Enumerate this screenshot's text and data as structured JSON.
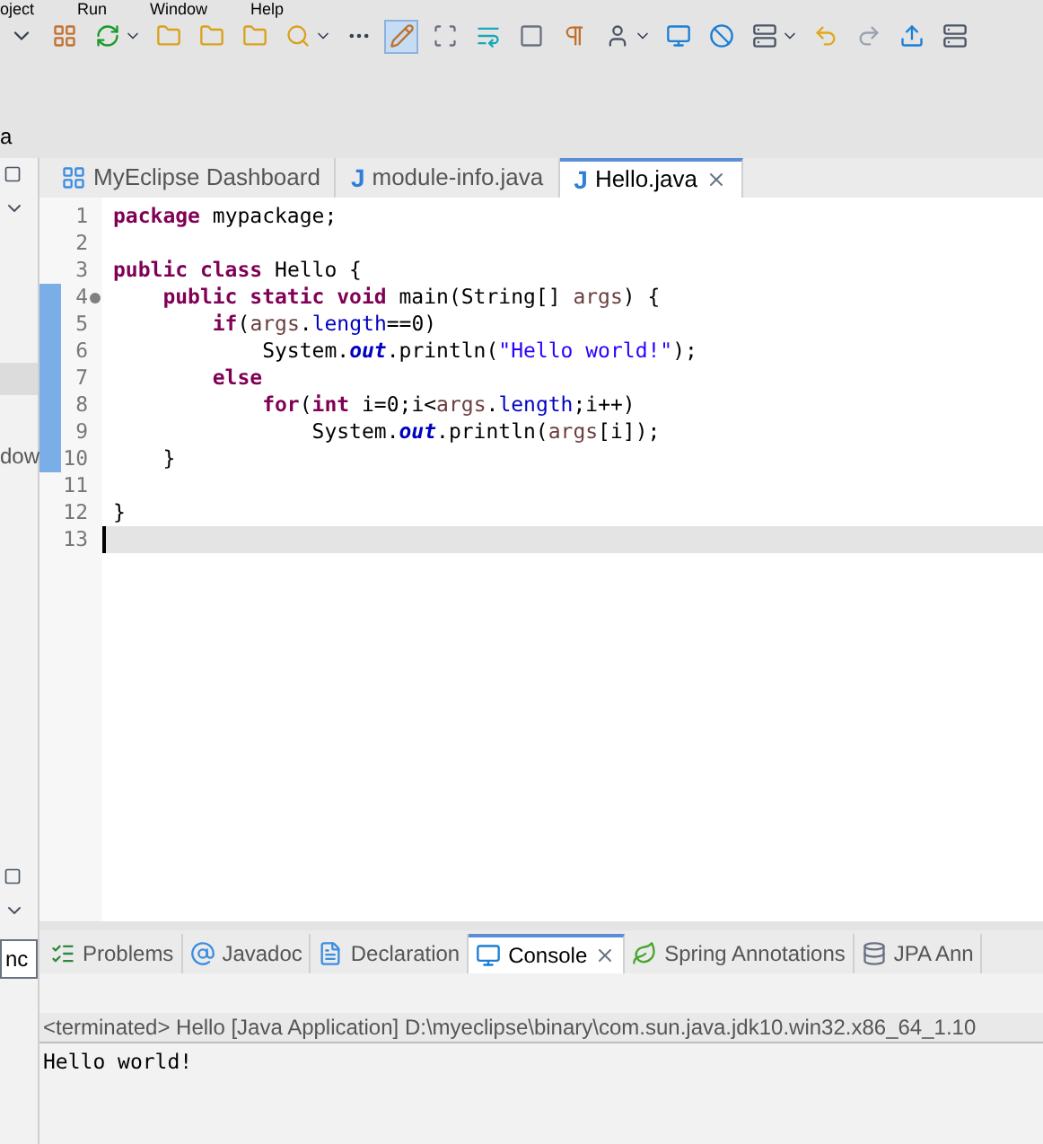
{
  "menu": [
    "oject",
    "Run",
    "Window",
    "Help"
  ],
  "toolbar": [
    {
      "selected": false
    },
    {
      "selected": false
    },
    {
      "selected": false
    },
    {
      "selected": false
    },
    {
      "selected": false
    },
    {
      "selected": false
    },
    {
      "selected": false
    },
    {
      "selected": false
    },
    {
      "selected": true
    },
    {
      "selected": false
    },
    {
      "selected": false
    },
    {
      "selected": false
    },
    {
      "selected": false
    },
    {
      "selected": false
    },
    {
      "selected": false
    },
    {
      "selected": false
    },
    {
      "selected": false
    },
    {
      "selected": false
    },
    {
      "selected": false
    },
    {
      "selected": false
    },
    {
      "selected": false
    }
  ],
  "left_panel": {
    "label_top": "a",
    "label_mid": "dow",
    "field_value": "nc"
  },
  "editor_tabs": [
    {
      "label": "MyEclipse Dashboard",
      "kind": "dashboard",
      "selected": false
    },
    {
      "label": "module-info.java",
      "kind": "java",
      "icon_text": "J",
      "selected": false
    },
    {
      "label": "Hello.java",
      "kind": "java",
      "icon_text": "J",
      "selected": true
    }
  ],
  "code_lines": [
    {
      "number": "1",
      "changed": false,
      "marker": false,
      "current": false,
      "tokens": [
        {
          "kind": "keyword",
          "text": "package"
        },
        {
          "kind": "plain",
          "text": " mypackage;"
        }
      ]
    },
    {
      "number": "2",
      "changed": false,
      "marker": false,
      "current": false
    },
    {
      "number": "3",
      "changed": false,
      "marker": false,
      "current": false,
      "tokens": [
        {
          "kind": "keyword",
          "text": "public class"
        },
        {
          "kind": "plain",
          "text": " Hello {"
        }
      ]
    },
    {
      "number": "4",
      "changed": true,
      "marker": true,
      "current": false,
      "tokens": [
        {
          "kind": "keyword",
          "text": "    public static void"
        },
        {
          "kind": "plain",
          "text": " main(String[] "
        },
        {
          "kind": "variable",
          "text": "args"
        },
        {
          "kind": "plain",
          "text": ") {"
        }
      ]
    },
    {
      "number": "5",
      "changed": true,
      "marker": false,
      "current": false,
      "tokens": [
        {
          "kind": "keyword",
          "text": "        if"
        },
        {
          "kind": "plain",
          "text": "("
        },
        {
          "kind": "variable",
          "text": "args"
        },
        {
          "kind": "plain",
          "text": "."
        },
        {
          "kind": "field",
          "text": "length"
        },
        {
          "kind": "plain",
          "text": "==0)"
        }
      ]
    },
    {
      "number": "6",
      "changed": true,
      "marker": false,
      "current": false,
      "tokens": [
        {
          "kind": "plain",
          "text": "            System."
        },
        {
          "kind": "static",
          "text": "out"
        },
        {
          "kind": "plain",
          "text": ".println("
        },
        {
          "kind": "string",
          "text": "\"Hello world!\""
        },
        {
          "kind": "plain",
          "text": ");"
        }
      ]
    },
    {
      "number": "7",
      "changed": true,
      "marker": false,
      "current": false,
      "tokens": [
        {
          "kind": "keyword",
          "text": "        else"
        }
      ]
    },
    {
      "number": "8",
      "changed": true,
      "marker": false,
      "current": false,
      "tokens": [
        {
          "kind": "keyword",
          "text": "            for"
        },
        {
          "kind": "plain",
          "text": "("
        },
        {
          "kind": "keyword",
          "text": "int"
        },
        {
          "kind": "plain",
          "text": " i=0;i<"
        },
        {
          "kind": "variable",
          "text": "args"
        },
        {
          "kind": "plain",
          "text": "."
        },
        {
          "kind": "field",
          "text": "length"
        },
        {
          "kind": "plain",
          "text": ";i++)"
        }
      ]
    },
    {
      "number": "9",
      "changed": true,
      "marker": false,
      "current": false,
      "tokens": [
        {
          "kind": "plain",
          "text": "                System."
        },
        {
          "kind": "static",
          "text": "out"
        },
        {
          "kind": "plain",
          "text": ".println("
        },
        {
          "kind": "variable",
          "text": "args"
        },
        {
          "kind": "plain",
          "text": "[i]);"
        }
      ]
    },
    {
      "number": "10",
      "changed": true,
      "marker": false,
      "current": false,
      "tokens": [
        {
          "kind": "plain",
          "text": "    }"
        }
      ]
    },
    {
      "number": "11",
      "changed": false,
      "marker": false,
      "current": false
    },
    {
      "number": "12",
      "changed": false,
      "marker": false,
      "current": false,
      "tokens": [
        {
          "kind": "plain",
          "text": "}"
        }
      ]
    },
    {
      "number": "13",
      "changed": false,
      "marker": false,
      "current": true
    }
  ],
  "bottom_tabs": [
    {
      "label": "Problems",
      "kind": "problems",
      "selected": false
    },
    {
      "label": "Javadoc",
      "kind": "javadoc",
      "selected": false
    },
    {
      "label": "Declaration",
      "kind": "declaration",
      "selected": false
    },
    {
      "label": "Console",
      "kind": "console",
      "selected": true
    },
    {
      "label": "Spring Annotations",
      "kind": "spring",
      "selected": false
    },
    {
      "label": "JPA Ann",
      "kind": "jpa",
      "selected": false
    }
  ],
  "console": {
    "header": "<terminated> Hello [Java Application] D:\\myeclipse\\binary\\com.sun.java.jdk10.win32.x86_64_1.10",
    "output": [
      "Hello world!"
    ]
  }
}
